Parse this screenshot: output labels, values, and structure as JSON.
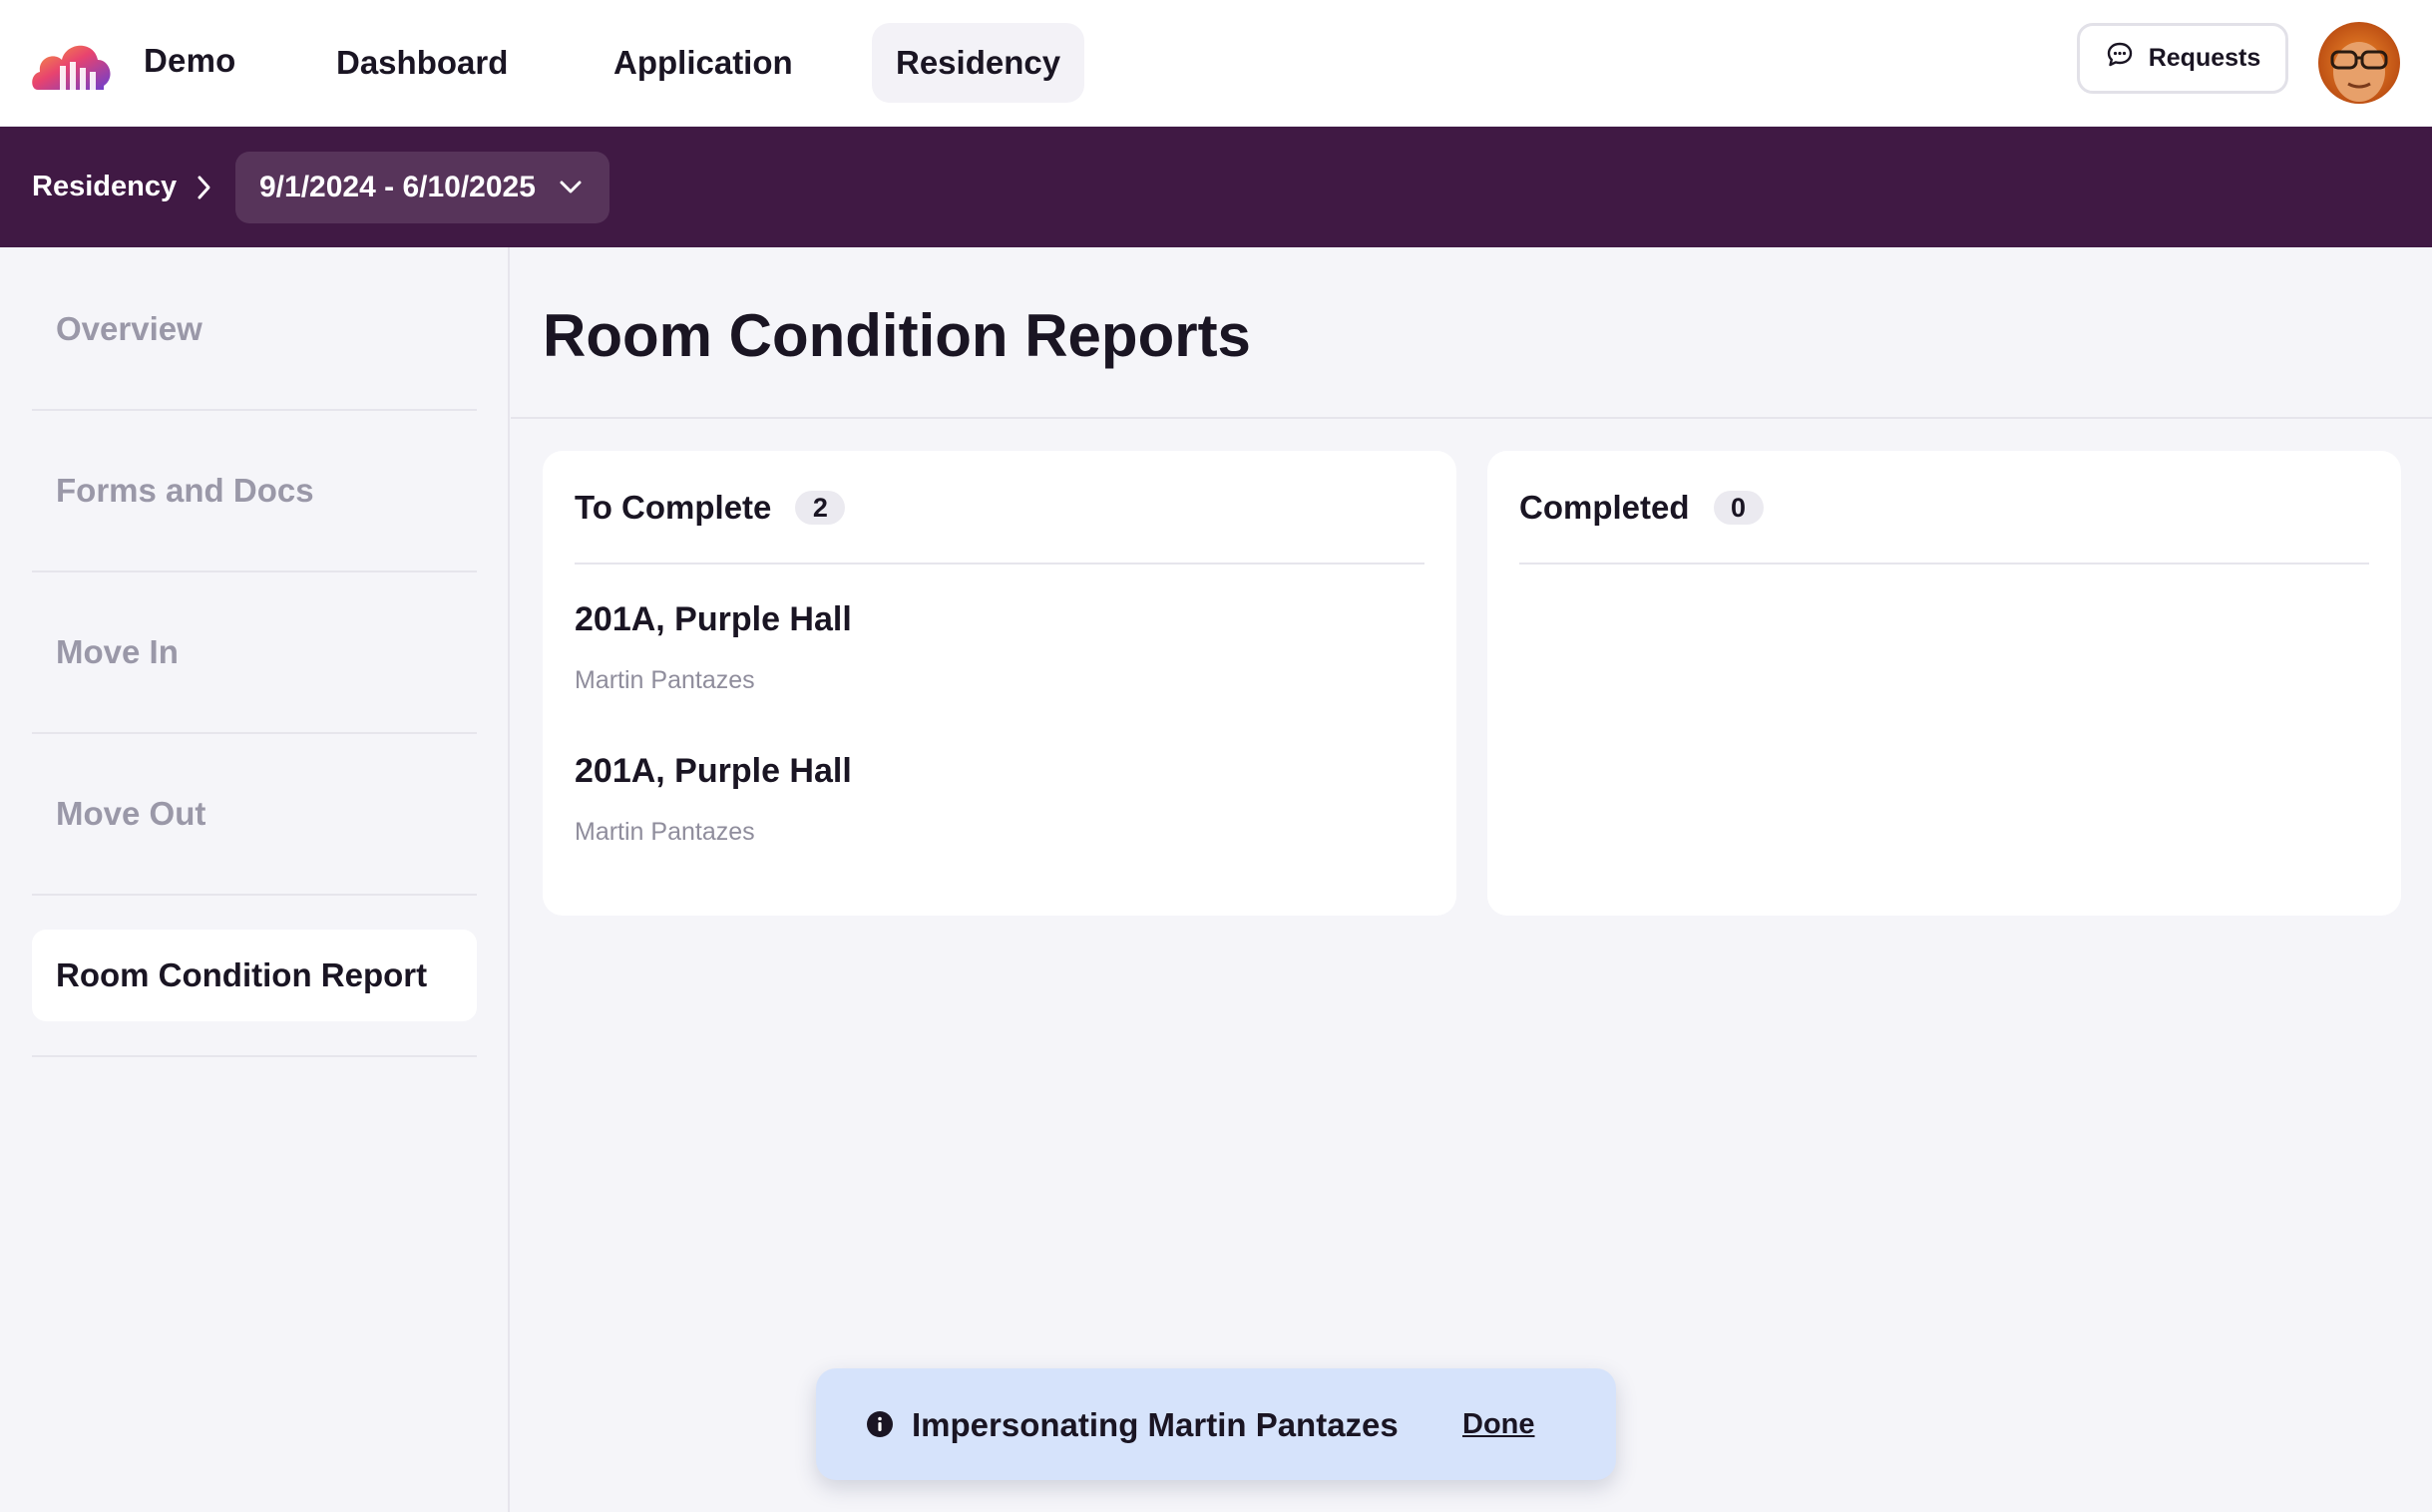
{
  "topnav": {
    "org_name": "Demo",
    "links": [
      {
        "label": "Dashboard",
        "active": false
      },
      {
        "label": "Application",
        "active": false
      },
      {
        "label": "Residency",
        "active": true
      }
    ],
    "requests_label": "Requests"
  },
  "breadcrumb": {
    "root": "Residency",
    "term": "9/1/2024 - 6/10/2025"
  },
  "sidebar": {
    "items": [
      {
        "label": "Overview",
        "active": false
      },
      {
        "label": "Forms and Docs",
        "active": false
      },
      {
        "label": "Move In",
        "active": false
      },
      {
        "label": "Move Out",
        "active": false
      },
      {
        "label": "Room Condition Report",
        "active": true
      }
    ]
  },
  "main": {
    "title": "Room Condition Reports",
    "to_complete": {
      "title": "To Complete",
      "count": "2",
      "items": [
        {
          "room": "201A, Purple Hall",
          "person": "Martin Pantazes"
        },
        {
          "room": "201A, Purple Hall",
          "person": "Martin Pantazes"
        }
      ]
    },
    "completed": {
      "title": "Completed",
      "count": "0",
      "items": []
    }
  },
  "toast": {
    "text": "Impersonating Martin Pantazes",
    "done_label": "Done"
  },
  "colors": {
    "brand_purple": "#401944",
    "toast_bg": "#d6e3fb",
    "page_bg": "#f5f5f9"
  }
}
